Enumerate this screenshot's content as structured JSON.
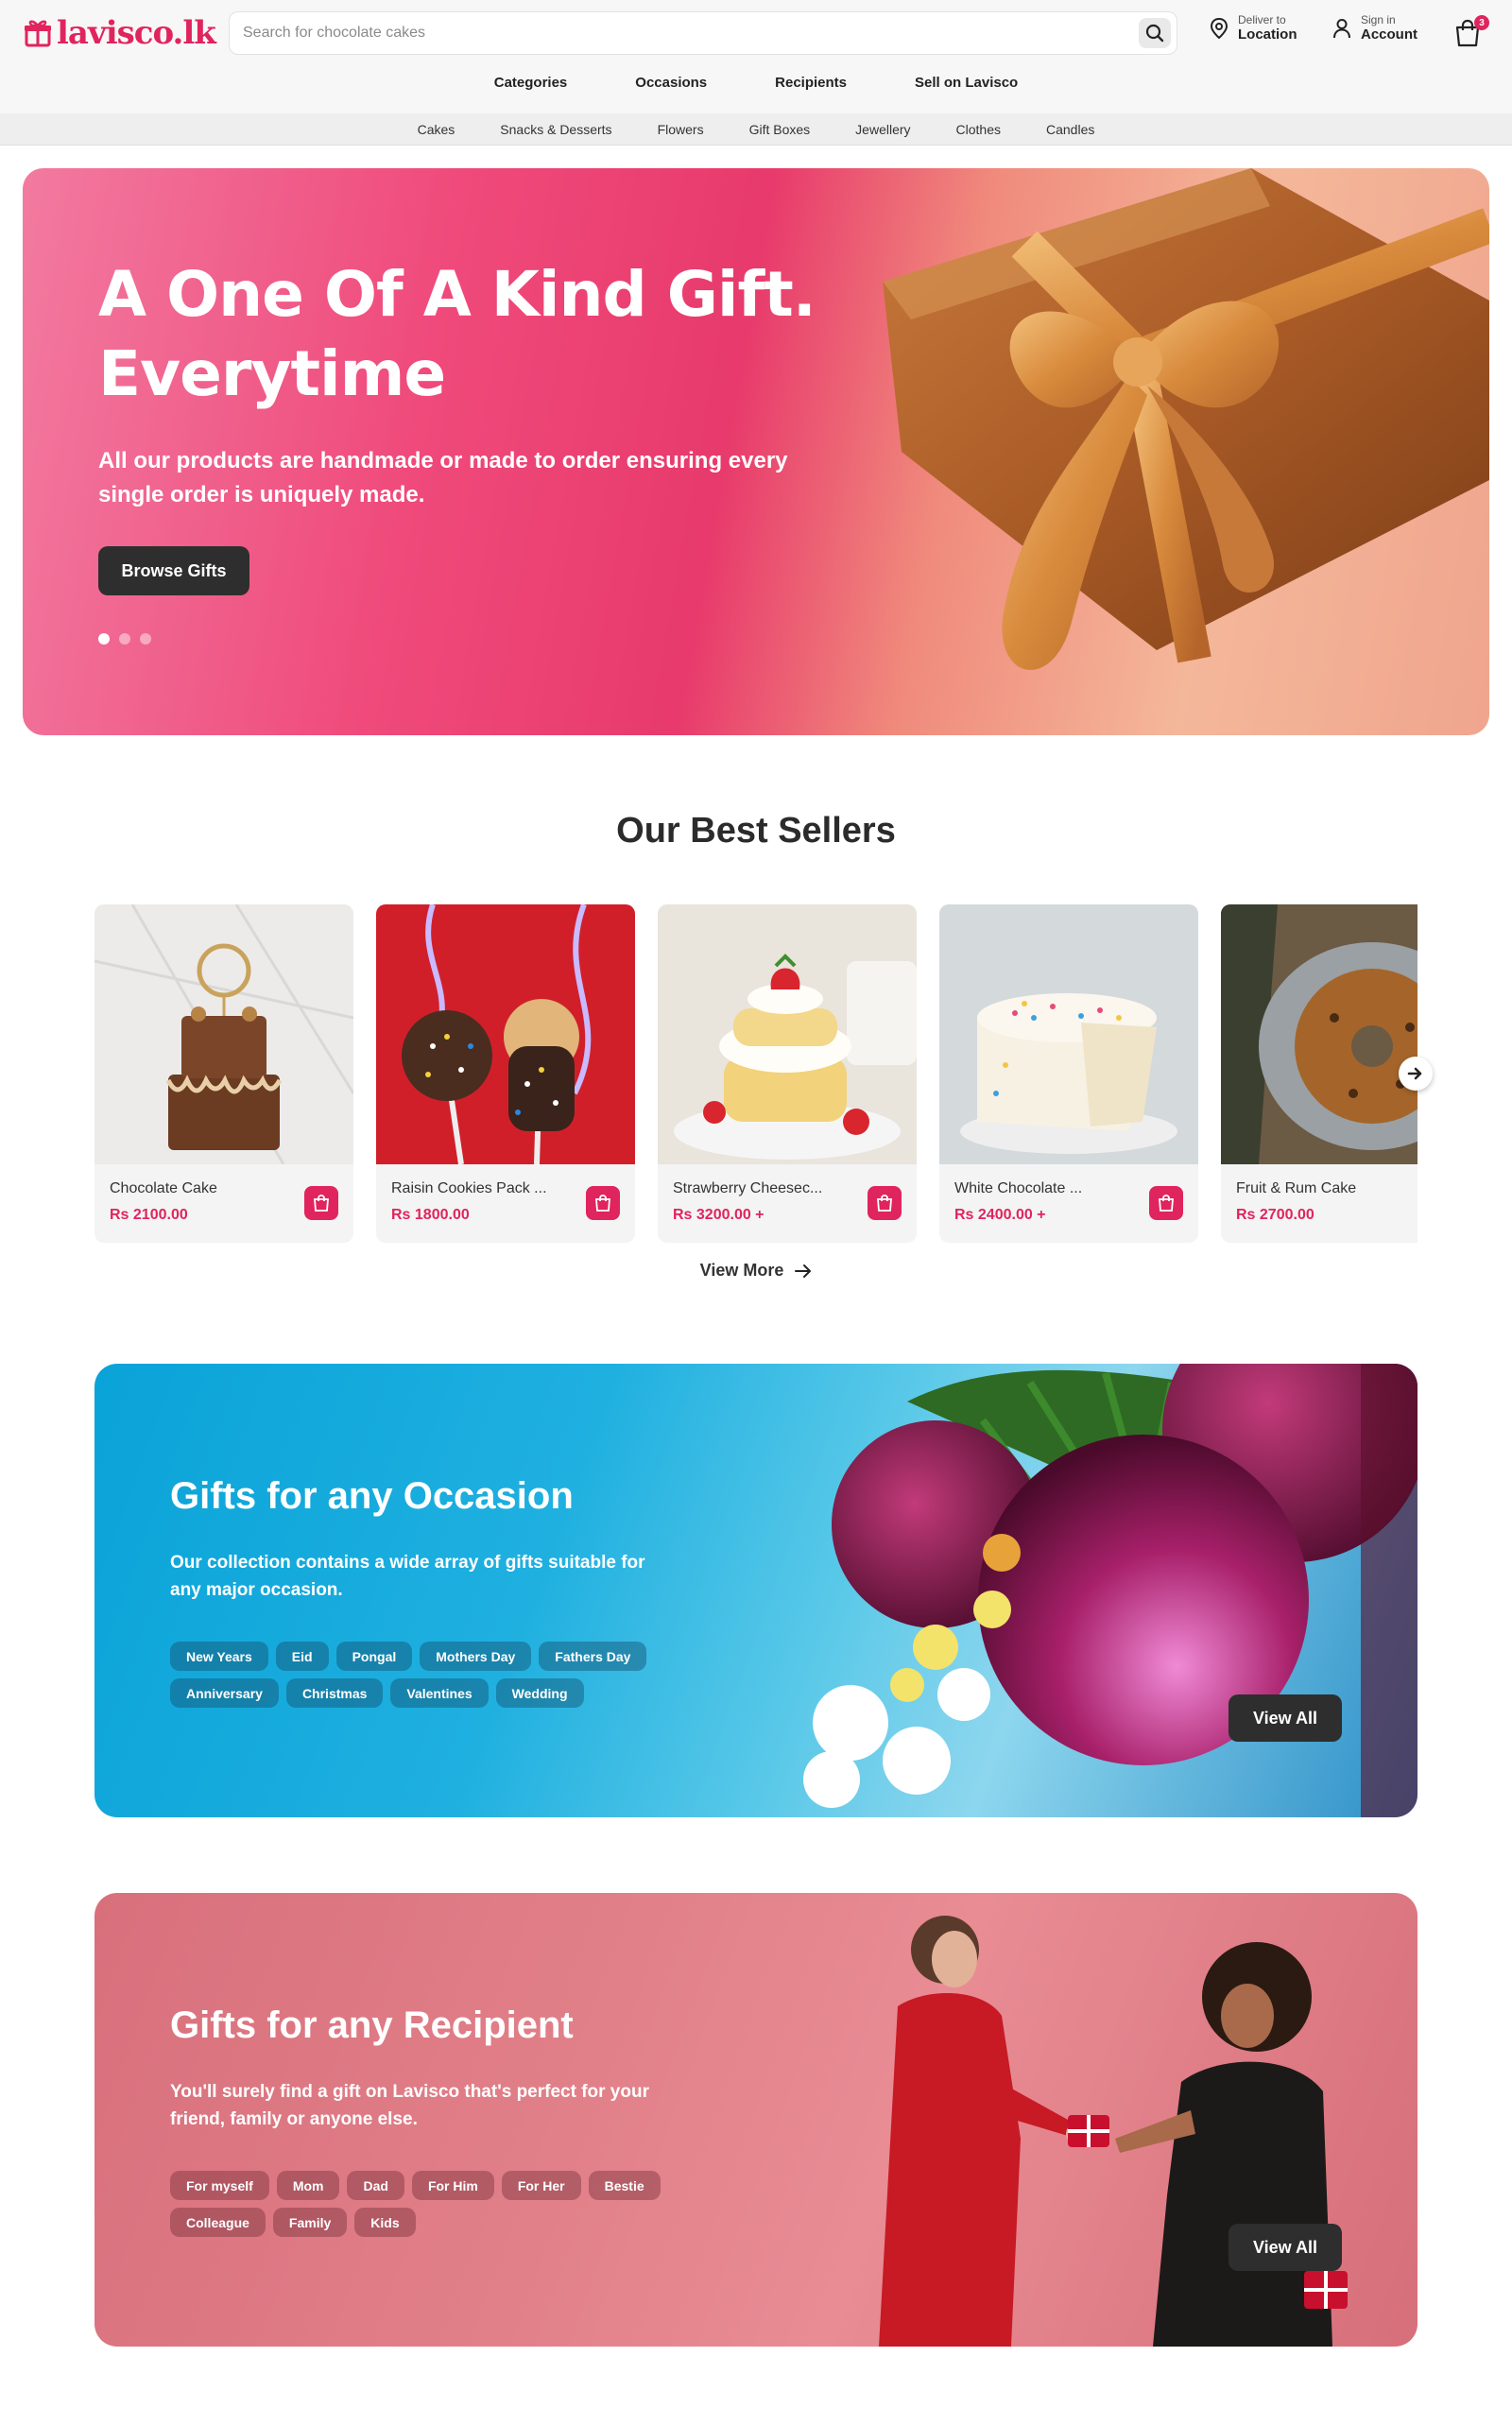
{
  "brand": {
    "name": "lavisco.lk",
    "color": "#e0245e"
  },
  "search": {
    "placeholder": "Search for chocolate cakes"
  },
  "header": {
    "deliver_small": "Deliver to",
    "deliver_big": "Location",
    "account_small": "Sign in",
    "account_big": "Account",
    "cart_count": "3"
  },
  "main_nav": [
    "Categories",
    "Occasions",
    "Recipients",
    "Sell on Lavisco"
  ],
  "sub_nav": [
    "Cakes",
    "Snacks & Desserts",
    "Flowers",
    "Gift Boxes",
    "Jewellery",
    "Clothes",
    "Candles"
  ],
  "hero": {
    "title_line1": "A One Of A Kind Gift.",
    "title_line2": "Everytime",
    "subtitle": "All our products are handmade or made to order ensuring every single order is uniquely made.",
    "button": "Browse Gifts",
    "slides": 3,
    "active_slide": 1
  },
  "best_sellers": {
    "title": "Our Best Sellers",
    "view_more": "View More",
    "products": [
      {
        "name": "Chocolate Cake",
        "price": "Rs 2100.00",
        "image": "chocolate-cake"
      },
      {
        "name": "Raisin Cookies Pack ...",
        "price": "Rs 1800.00",
        "image": "cookie-pops"
      },
      {
        "name": "Strawberry Cheesec...",
        "price": "Rs 3200.00 +",
        "image": "strawberry-shortcake"
      },
      {
        "name": "White Chocolate ...",
        "price": "Rs 2400.00 +",
        "image": "white-chocolate-cake"
      },
      {
        "name": "Fruit & Rum Cake",
        "price": "Rs 2700.00",
        "image": "rum-cake"
      }
    ]
  },
  "occasion": {
    "title": "Gifts for any Occasion",
    "subtitle": "Our collection contains a wide array of gifts suitable for any major occasion.",
    "tags": [
      "New Years",
      "Eid",
      "Pongal",
      "Mothers Day",
      "Fathers Day",
      "Anniversary",
      "Christmas",
      "Valentines",
      "Wedding"
    ],
    "button": "View All"
  },
  "recipient": {
    "title": "Gifts for any Recipient",
    "subtitle": "You'll surely find a gift on Lavisco that's perfect for your friend, family or anyone else.",
    "tags": [
      "For myself",
      "Mom",
      "Dad",
      "For Him",
      "For Her",
      "Bestie",
      "Colleague",
      "Family",
      "Kids"
    ],
    "button": "View All"
  }
}
